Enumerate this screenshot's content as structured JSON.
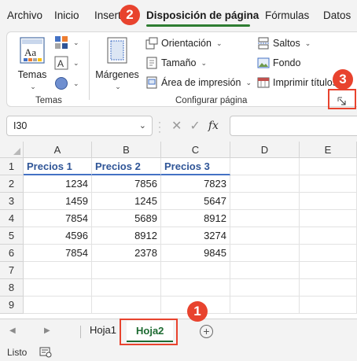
{
  "ribbon_tabs": [
    "Archivo",
    "Inicio",
    "Insert",
    "Disposición de página",
    "Fórmulas",
    "Datos"
  ],
  "active_tab": "Disposición de página",
  "groups": {
    "temas": {
      "label": "Temas",
      "button": "Temas"
    },
    "configurar": {
      "label": "Configurar página",
      "margenes": "Márgenes",
      "orientacion": "Orientación",
      "tamano": "Tamaño",
      "area_impresion": "Área de impresión",
      "saltos": "Saltos",
      "fondo": "Fondo",
      "imprimir_titulos": "Imprimir títulos"
    }
  },
  "formula_bar": {
    "name_box": "I30",
    "fx": "fx",
    "value": ""
  },
  "columns": [
    "A",
    "B",
    "C",
    "D",
    "E"
  ],
  "rows": [
    "1",
    "2",
    "3",
    "4",
    "5",
    "6",
    "7",
    "8",
    "9"
  ],
  "table": {
    "headers": [
      "Precios 1",
      "Precios 2",
      "Precios 3"
    ],
    "rows": [
      [
        "1234",
        "7856",
        "7823"
      ],
      [
        "1459",
        "1245",
        "5647"
      ],
      [
        "7854",
        "5689",
        "8912"
      ],
      [
        "4596",
        "8912",
        "3274"
      ],
      [
        "7854",
        "2378",
        "9845"
      ]
    ]
  },
  "sheets": [
    "Hoja1",
    "Hoja2"
  ],
  "active_sheet": "Hoja2",
  "status": "Listo",
  "callouts": [
    "1",
    "2",
    "3"
  ],
  "colors": {
    "accent": "#1e6b32",
    "callout": "#e8432e",
    "header_text": "#2f5597",
    "header_border": "#4472c4"
  }
}
